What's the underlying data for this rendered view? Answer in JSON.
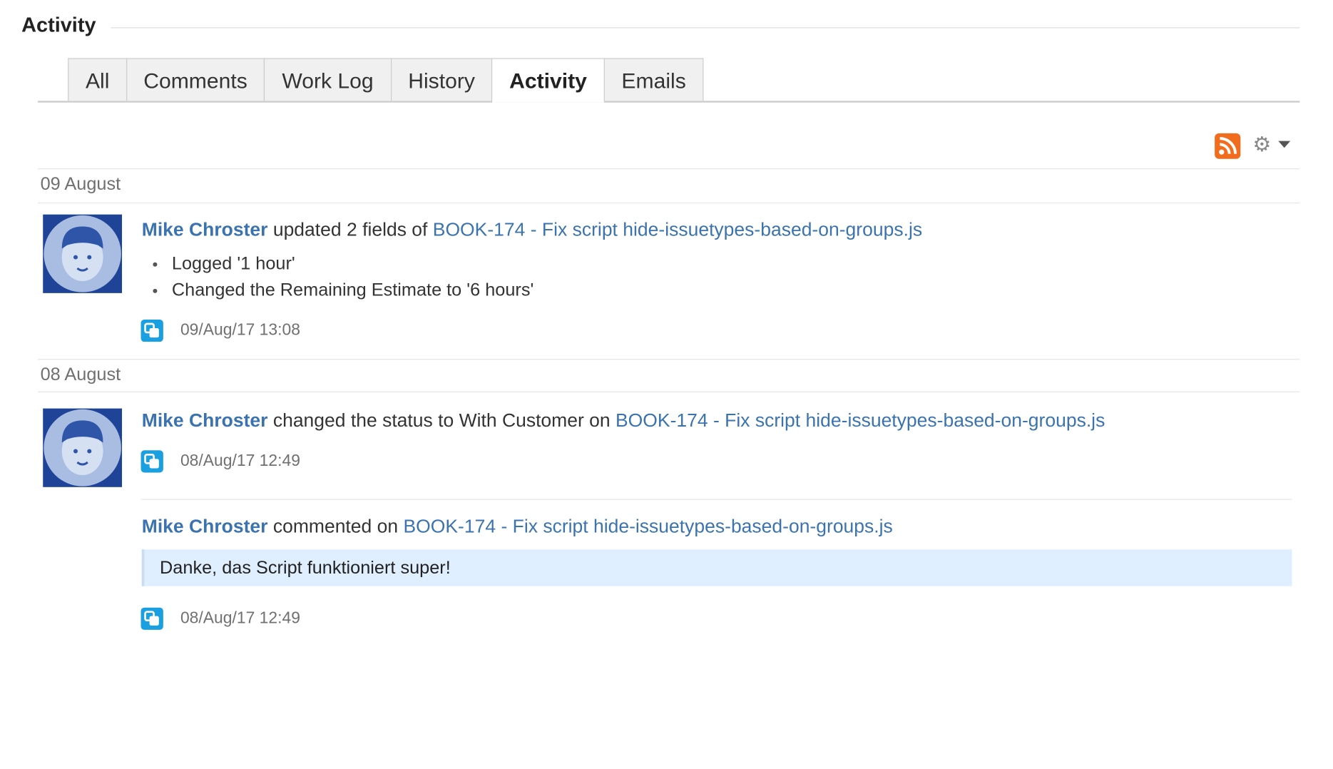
{
  "section": {
    "title": "Activity"
  },
  "tabs": [
    {
      "label": "All",
      "active": false
    },
    {
      "label": "Comments",
      "active": false
    },
    {
      "label": "Work Log",
      "active": false
    },
    {
      "label": "History",
      "active": false
    },
    {
      "label": "Activity",
      "active": true
    },
    {
      "label": "Emails",
      "active": false
    }
  ],
  "toolbar": {
    "rss_icon": "rss-feed-icon",
    "settings_icon": "gear-icon"
  },
  "colors": {
    "link": "#3b73af",
    "avatar_bg": "#1f4396",
    "rss": "#f26c1d",
    "app_icon": "#1a9fe0",
    "comment_bg": "#e0efff"
  },
  "groups": [
    {
      "date": "09 August",
      "entries": [
        {
          "user": "Mike Chroster",
          "action": " updated 2 fields of ",
          "issue": "BOOK-174 - Fix script hide-issuetypes-based-on-groups.js",
          "details": [
            "Logged '1 hour'",
            "Changed the Remaining Estimate to '6 hours'"
          ],
          "time": "09/Aug/17 13:08"
        }
      ]
    },
    {
      "date": "08 August",
      "entries": [
        {
          "user": "Mike Chroster",
          "action": " changed the status to With Customer on ",
          "issue": "BOOK-174 - Fix script hide-issuetypes-based-on-groups.js",
          "time": "08/Aug/17 12:49"
        },
        {
          "user": "Mike Chroster",
          "action": " commented on ",
          "issue": "BOOK-174 - Fix script hide-issuetypes-based-on-groups.js",
          "comment": "Danke, das Script funktioniert super!",
          "time": "08/Aug/17 12:49"
        }
      ]
    }
  ]
}
